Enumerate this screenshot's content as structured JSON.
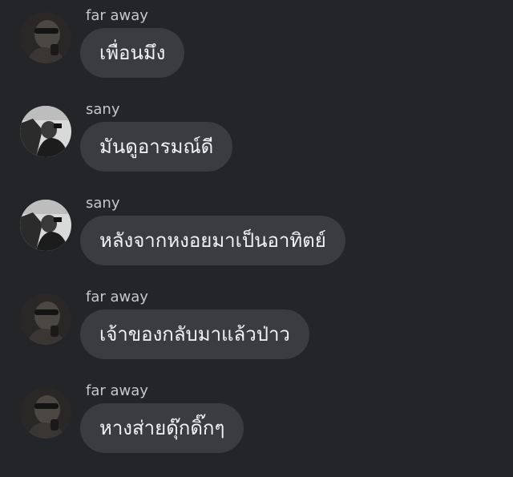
{
  "messages": [
    {
      "sender": "far away",
      "text": "เพื่อนมึง"
    },
    {
      "sender": "sany",
      "text": "มันดูอารมณ์ดี"
    },
    {
      "sender": "sany",
      "text": "หลังจากหงอยมาเป็นอาทิตย์"
    },
    {
      "sender": "far away",
      "text": "เจ้าของกลับมาแล้วป่าว"
    },
    {
      "sender": "far away",
      "text": "หางส่ายดุ๊กดิ๊กๆ"
    }
  ],
  "colors": {
    "background": "#242529",
    "bubble": "#3b3c42",
    "bubble_text": "#f2f2f4",
    "sender_text": "#c6c7cb"
  },
  "icons": {
    "far_away_avatar": "profile-photo-dark",
    "sany_avatar": "profile-photo-light"
  }
}
